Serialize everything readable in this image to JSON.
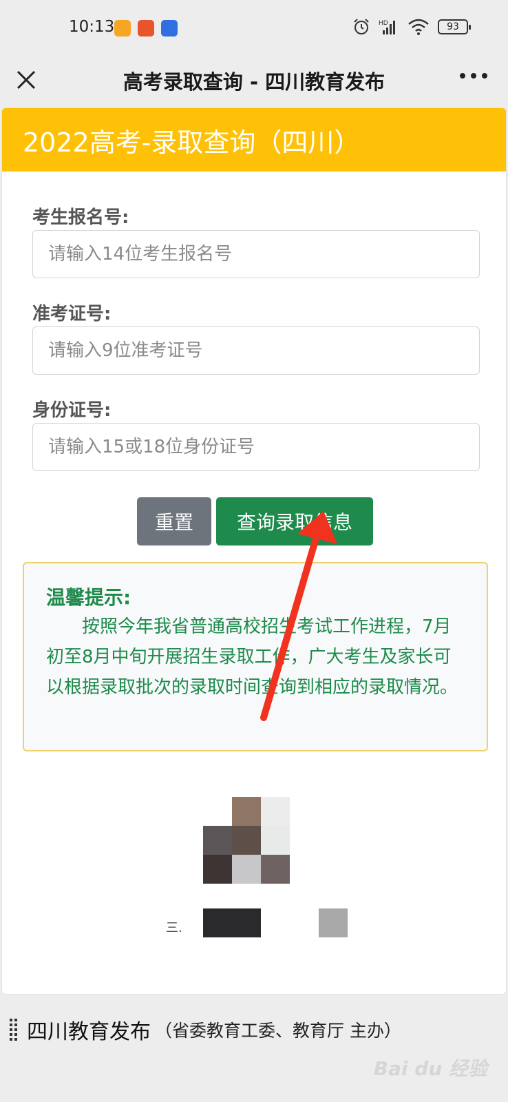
{
  "status_bar": {
    "time": "10:13",
    "battery": "93",
    "icons": [
      "app-icon-yellow",
      "app-icon-red",
      "app-icon-blue",
      "alarm-icon",
      "signal-icon",
      "wifi-icon",
      "battery-icon"
    ]
  },
  "nav": {
    "title": "高考录取查询 - 四川教育发布"
  },
  "form": {
    "header": "2022高考-录取查询（四川）",
    "fields": [
      {
        "label": "考生报名号:",
        "placeholder": "请输入14位考生报名号",
        "value": ""
      },
      {
        "label": "准考证号:",
        "placeholder": "请输入9位准考证号",
        "value": ""
      },
      {
        "label": "身份证号:",
        "placeholder": "请输入15或18位身份证号",
        "value": ""
      }
    ],
    "reset_label": "重置",
    "query_label": "查询录取信息"
  },
  "notice": {
    "title": "温馨提示:",
    "body": "按照今年我省普通高校招生考试工作进程，7月初至8月中旬开展招生录取工作，广大考生及家长可以根据录取批次的录取时间查询到相应的录取情况。"
  },
  "footer": {
    "name": "四川教育发布",
    "subtitle": "（省委教育工委、教育厅 主办）"
  },
  "colors": {
    "header_bg": "#fec107",
    "query_button": "#1e8a4c",
    "reset_button": "#6d747b",
    "notice_text": "#1e8a4c",
    "notice_border": "#f0d06b",
    "arrow": "#f0321e"
  }
}
